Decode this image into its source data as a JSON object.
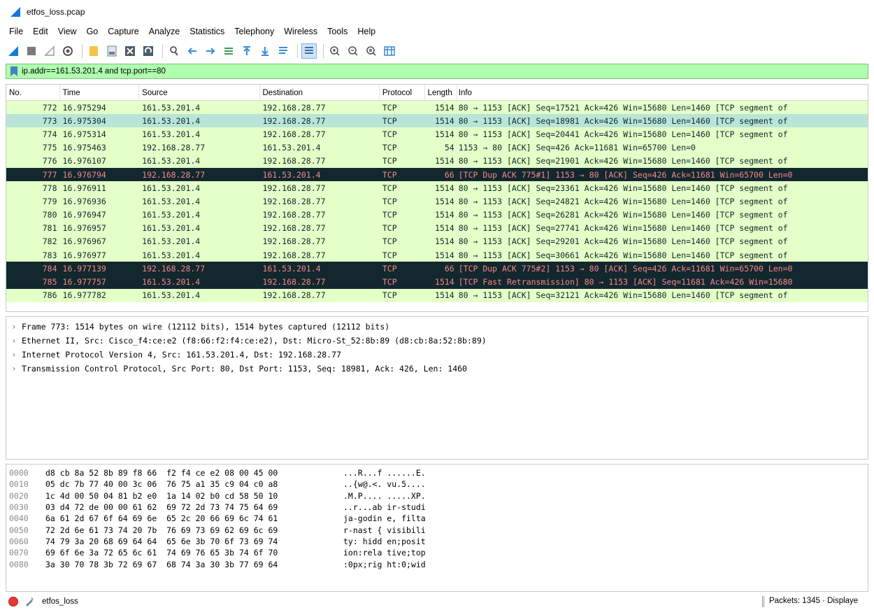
{
  "window": {
    "title": "etfos_loss.pcap"
  },
  "menu": [
    "File",
    "Edit",
    "View",
    "Go",
    "Capture",
    "Analyze",
    "Statistics",
    "Telephony",
    "Wireless",
    "Tools",
    "Help"
  ],
  "filter": {
    "value": "ip.addr==161.53.201.4 and tcp.port==80"
  },
  "packet_list": {
    "columns": [
      "No.",
      "Time",
      "Source",
      "Destination",
      "Protocol",
      "Length",
      "Info"
    ],
    "rows": [
      {
        "no": "772",
        "time": "16.975294",
        "src": "161.53.201.4",
        "dst": "192.168.28.77",
        "proto": "TCP",
        "len": "1514",
        "info": "80 → 1153 [ACK] Seq=17521 Ack=426 Win=15680 Len=1460 [TCP segment of",
        "style": "green"
      },
      {
        "no": "773",
        "time": "16.975304",
        "src": "161.53.201.4",
        "dst": "192.168.28.77",
        "proto": "TCP",
        "len": "1514",
        "info": "80 → 1153 [ACK] Seq=18981 Ack=426 Win=15680 Len=1460 [TCP segment of",
        "style": "selected"
      },
      {
        "no": "774",
        "time": "16.975314",
        "src": "161.53.201.4",
        "dst": "192.168.28.77",
        "proto": "TCP",
        "len": "1514",
        "info": "80 → 1153 [ACK] Seq=20441 Ack=426 Win=15680 Len=1460 [TCP segment of",
        "style": "green"
      },
      {
        "no": "775",
        "time": "16.975463",
        "src": "192.168.28.77",
        "dst": "161.53.201.4",
        "proto": "TCP",
        "len": "54",
        "info": "1153 → 80 [ACK] Seq=426 Ack=11681 Win=65700 Len=0",
        "style": "green"
      },
      {
        "no": "776",
        "time": "16.976107",
        "src": "161.53.201.4",
        "dst": "192.168.28.77",
        "proto": "TCP",
        "len": "1514",
        "info": "80 → 1153 [ACK] Seq=21901 Ack=426 Win=15680 Len=1460 [TCP segment of",
        "style": "green"
      },
      {
        "no": "777",
        "time": "16.976794",
        "src": "192.168.28.77",
        "dst": "161.53.201.4",
        "proto": "TCP",
        "len": "66",
        "info": "[TCP Dup ACK 775#1] 1153 → 80 [ACK] Seq=426 Ack=11681 Win=65700 Len=0",
        "style": "dark"
      },
      {
        "no": "778",
        "time": "16.976911",
        "src": "161.53.201.4",
        "dst": "192.168.28.77",
        "proto": "TCP",
        "len": "1514",
        "info": "80 → 1153 [ACK] Seq=23361 Ack=426 Win=15680 Len=1460 [TCP segment of",
        "style": "green"
      },
      {
        "no": "779",
        "time": "16.976936",
        "src": "161.53.201.4",
        "dst": "192.168.28.77",
        "proto": "TCP",
        "len": "1514",
        "info": "80 → 1153 [ACK] Seq=24821 Ack=426 Win=15680 Len=1460 [TCP segment of",
        "style": "green"
      },
      {
        "no": "780",
        "time": "16.976947",
        "src": "161.53.201.4",
        "dst": "192.168.28.77",
        "proto": "TCP",
        "len": "1514",
        "info": "80 → 1153 [ACK] Seq=26281 Ack=426 Win=15680 Len=1460 [TCP segment of",
        "style": "green"
      },
      {
        "no": "781",
        "time": "16.976957",
        "src": "161.53.201.4",
        "dst": "192.168.28.77",
        "proto": "TCP",
        "len": "1514",
        "info": "80 → 1153 [ACK] Seq=27741 Ack=426 Win=15680 Len=1460 [TCP segment of",
        "style": "green"
      },
      {
        "no": "782",
        "time": "16.976967",
        "src": "161.53.201.4",
        "dst": "192.168.28.77",
        "proto": "TCP",
        "len": "1514",
        "info": "80 → 1153 [ACK] Seq=29201 Ack=426 Win=15680 Len=1460 [TCP segment of",
        "style": "green"
      },
      {
        "no": "783",
        "time": "16.976977",
        "src": "161.53.201.4",
        "dst": "192.168.28.77",
        "proto": "TCP",
        "len": "1514",
        "info": "80 → 1153 [ACK] Seq=30661 Ack=426 Win=15680 Len=1460 [TCP segment of",
        "style": "green"
      },
      {
        "no": "784",
        "time": "16.977139",
        "src": "192.168.28.77",
        "dst": "161.53.201.4",
        "proto": "TCP",
        "len": "66",
        "info": "[TCP Dup ACK 775#2] 1153 → 80 [ACK] Seq=426 Ack=11681 Win=65700 Len=0",
        "style": "dark"
      },
      {
        "no": "785",
        "time": "16.977757",
        "src": "161.53.201.4",
        "dst": "192.168.28.77",
        "proto": "TCP",
        "len": "1514",
        "info": "[TCP Fast Retransmission] 80 → 1153 [ACK] Seq=11681 Ack=426 Win=15680",
        "style": "dark"
      },
      {
        "no": "786",
        "time": "16.977782",
        "src": "161.53.201.4",
        "dst": "192.168.28.77",
        "proto": "TCP",
        "len": "1514",
        "info": "80 → 1153 [ACK] Seq=32121 Ack=426 Win=15680 Len=1460 [TCP segment of",
        "style": "green"
      }
    ]
  },
  "details": [
    "Frame 773: 1514 bytes on wire (12112 bits), 1514 bytes captured (12112 bits)",
    "Ethernet II, Src: Cisco_f4:ce:e2 (f8:66:f2:f4:ce:e2), Dst: Micro-St_52:8b:89 (d8:cb:8a:52:8b:89)",
    "Internet Protocol Version 4, Src: 161.53.201.4, Dst: 192.168.28.77",
    "Transmission Control Protocol, Src Port: 80, Dst Port: 1153, Seq: 18981, Ack: 426, Len: 1460"
  ],
  "hex": [
    {
      "off": "0000",
      "bytes": "d8 cb 8a 52 8b 89 f8 66  f2 f4 ce e2 08 00 45 00",
      "ascii": "...R...f ......E."
    },
    {
      "off": "0010",
      "bytes": "05 dc 7b 77 40 00 3c 06  76 75 a1 35 c9 04 c0 a8",
      "ascii": "..{w@.<. vu.5...."
    },
    {
      "off": "0020",
      "bytes": "1c 4d 00 50 04 81 b2 e0  1a 14 02 b0 cd 58 50 10",
      "ascii": ".M.P.... .....XP."
    },
    {
      "off": "0030",
      "bytes": "03 d4 72 de 00 00 61 62  69 72 2d 73 74 75 64 69",
      "ascii": "..r...ab ir-studi"
    },
    {
      "off": "0040",
      "bytes": "6a 61 2d 67 6f 64 69 6e  65 2c 20 66 69 6c 74 61",
      "ascii": "ja-godin e, filta"
    },
    {
      "off": "0050",
      "bytes": "72 2d 6e 61 73 74 20 7b  76 69 73 69 62 69 6c 69",
      "ascii": "r-nast { visibili"
    },
    {
      "off": "0060",
      "bytes": "74 79 3a 20 68 69 64 64  65 6e 3b 70 6f 73 69 74",
      "ascii": "ty: hidd en;posit"
    },
    {
      "off": "0070",
      "bytes": "69 6f 6e 3a 72 65 6c 61  74 69 76 65 3b 74 6f 70",
      "ascii": "ion:rela tive;top"
    },
    {
      "off": "0080",
      "bytes": "3a 30 70 78 3b 72 69 67  68 74 3a 30 3b 77 69 64",
      "ascii": ":0px;rig ht:0;wid"
    }
  ],
  "status": {
    "profile": "etfos_loss",
    "packets": "Packets: 1345 · Displaye"
  },
  "colors": {
    "green_row": "#e4ffc7",
    "selected_row": "#b9e5d8",
    "dark_row": "#12272e",
    "dark_text": "#f78787",
    "filter_bg": "#afffaf"
  }
}
